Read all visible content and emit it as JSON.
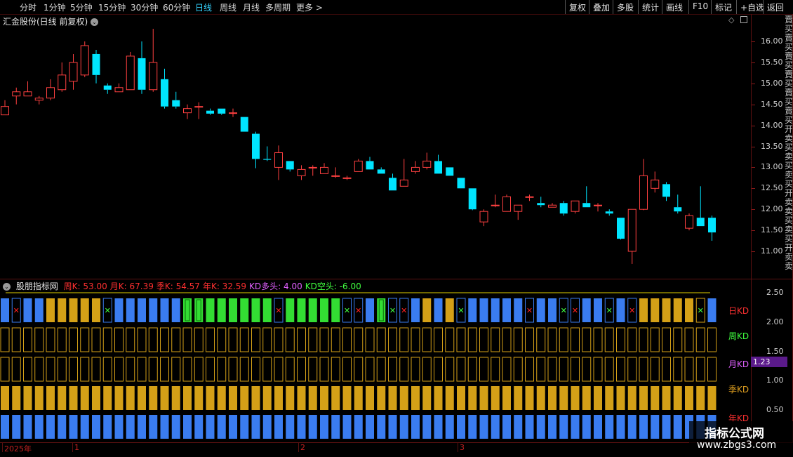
{
  "toolbar": {
    "periods": [
      {
        "label": "分时",
        "active": false
      },
      {
        "label": "1分钟",
        "active": false
      },
      {
        "label": "5分钟",
        "active": false
      },
      {
        "label": "15分钟",
        "active": false
      },
      {
        "label": "30分钟",
        "active": false
      },
      {
        "label": "60分钟",
        "active": false
      },
      {
        "label": "日线",
        "active": true
      },
      {
        "label": "周线",
        "active": false
      },
      {
        "label": "月线",
        "active": false
      },
      {
        "label": "多周期",
        "active": false
      },
      {
        "label": "更多 >",
        "active": false
      }
    ],
    "right_buttons": [
      "复权",
      "叠加",
      "多股",
      "统计",
      "画线",
      "F10",
      "标记",
      "+自选",
      "返回"
    ]
  },
  "stock_title": "汇金股份(日线 前复权)",
  "price_axis": [
    "16.00",
    "15.50",
    "15.00",
    "14.50",
    "14.00",
    "13.50",
    "13.00",
    "12.50",
    "12.00",
    "11.50",
    "11.00"
  ],
  "indicator": {
    "name": "股朋指标网",
    "values": [
      {
        "label": "周K: 53.00",
        "color": "#ff3030"
      },
      {
        "label": "月K: 67.39",
        "color": "#ff3030"
      },
      {
        "label": "季K: 54.57",
        "color": "#ff3030"
      },
      {
        "label": "年K: 32.59",
        "color": "#ff3030"
      },
      {
        "label": "KD多头: 4.00",
        "color": "#e060ff"
      },
      {
        "label": "KD空头: -6.00",
        "color": "#40ff40"
      }
    ],
    "row_labels": [
      {
        "label": "日KD",
        "color": "#ff3030"
      },
      {
        "label": "周KD",
        "color": "#40ff40"
      },
      {
        "label": "月KD",
        "color": "#e060ff"
      },
      {
        "label": "季KD",
        "color": "#e0a020"
      },
      {
        "label": "年KD",
        "color": "#ff3030"
      }
    ],
    "axis": [
      "2.50",
      "2.00",
      "1.50",
      "1.00",
      "0.50"
    ],
    "cursor_value": "1.23"
  },
  "dates": [
    "2025年",
    "1",
    "2",
    "3"
  ],
  "right_edge_text": "賣买賣买賣买賣买賣买賣买开卖买卖买卖买开卖卖买卖买开卖卖",
  "watermark": {
    "title": "指标公式网",
    "url": "www.zbgs3.com"
  },
  "colors": {
    "up": "#ff4040",
    "down": "#00e5ff",
    "blue": "#3a7cf0",
    "gold": "#d4a017",
    "green": "#33dd33"
  },
  "candles": [
    {
      "o": 14.25,
      "c": 14.45,
      "h": 14.6,
      "l": 14.25
    },
    {
      "o": 14.7,
      "c": 14.8,
      "h": 14.9,
      "l": 14.5
    },
    {
      "o": 14.7,
      "c": 14.8,
      "h": 15.05,
      "l": 14.7
    },
    {
      "o": 14.6,
      "c": 14.65,
      "h": 14.7,
      "l": 14.5
    },
    {
      "o": 14.65,
      "c": 14.9,
      "h": 15.1,
      "l": 14.6
    },
    {
      "o": 14.85,
      "c": 15.2,
      "h": 15.5,
      "l": 14.8
    },
    {
      "o": 15.05,
      "c": 15.5,
      "h": 15.7,
      "l": 14.85
    },
    {
      "o": 15.2,
      "c": 15.9,
      "h": 16.0,
      "l": 15.15
    },
    {
      "o": 15.7,
      "c": 15.2,
      "h": 15.8,
      "l": 15.0
    },
    {
      "o": 14.95,
      "c": 14.85,
      "h": 15.0,
      "l": 14.75
    },
    {
      "o": 14.8,
      "c": 14.9,
      "h": 15.0,
      "l": 14.8
    },
    {
      "o": 14.85,
      "c": 15.65,
      "h": 15.75,
      "l": 14.85
    },
    {
      "o": 15.6,
      "c": 14.85,
      "h": 16.0,
      "l": 14.75
    },
    {
      "o": 14.85,
      "c": 15.5,
      "h": 16.3,
      "l": 14.8
    },
    {
      "o": 15.1,
      "c": 14.45,
      "h": 15.35,
      "l": 14.4
    },
    {
      "o": 14.6,
      "c": 14.45,
      "h": 14.8,
      "l": 14.4
    },
    {
      "o": 14.3,
      "c": 14.4,
      "h": 14.5,
      "l": 14.15
    },
    {
      "o": 14.45,
      "c": 14.45,
      "h": 14.55,
      "l": 14.15
    },
    {
      "o": 14.35,
      "c": 14.28,
      "h": 14.4,
      "l": 14.25
    },
    {
      "o": 14.4,
      "c": 14.28,
      "h": 14.4,
      "l": 14.25
    },
    {
      "o": 14.3,
      "c": 14.3,
      "h": 14.4,
      "l": 14.2
    },
    {
      "o": 14.2,
      "c": 13.85,
      "h": 14.2,
      "l": 13.85
    },
    {
      "o": 13.8,
      "c": 13.2,
      "h": 13.85,
      "l": 12.98
    },
    {
      "o": 13.2,
      "c": 13.18,
      "h": 13.5,
      "l": 13.15
    },
    {
      "o": 13.0,
      "c": 13.35,
      "h": 13.52,
      "l": 12.7
    },
    {
      "o": 13.15,
      "c": 12.95,
      "h": 13.15,
      "l": 12.9
    },
    {
      "o": 12.8,
      "c": 12.95,
      "h": 13.05,
      "l": 12.7
    },
    {
      "o": 13.0,
      "c": 13.0,
      "h": 13.05,
      "l": 12.8
    },
    {
      "o": 12.85,
      "c": 13.0,
      "h": 13.1,
      "l": 12.85
    },
    {
      "o": 12.8,
      "c": 12.8,
      "h": 13.0,
      "l": 12.75
    },
    {
      "o": 12.75,
      "c": 12.75,
      "h": 12.8,
      "l": 12.7
    },
    {
      "o": 12.9,
      "c": 13.15,
      "h": 13.2,
      "l": 12.9
    },
    {
      "o": 13.15,
      "c": 12.95,
      "h": 13.25,
      "l": 12.95
    },
    {
      "o": 12.95,
      "c": 12.85,
      "h": 13.0,
      "l": 12.85
    },
    {
      "o": 12.75,
      "c": 12.45,
      "h": 12.85,
      "l": 12.45
    },
    {
      "o": 12.55,
      "c": 12.7,
      "h": 13.2,
      "l": 12.55
    },
    {
      "o": 12.9,
      "c": 13.0,
      "h": 13.15,
      "l": 12.85
    },
    {
      "o": 13.0,
      "c": 13.15,
      "h": 13.35,
      "l": 12.95
    },
    {
      "o": 13.15,
      "c": 12.85,
      "h": 13.3,
      "l": 12.85
    },
    {
      "o": 13.0,
      "c": 12.8,
      "h": 13.0,
      "l": 12.8
    },
    {
      "o": 12.75,
      "c": 12.5,
      "h": 12.75,
      "l": 12.5
    },
    {
      "o": 12.5,
      "c": 12.0,
      "h": 12.5,
      "l": 11.98
    },
    {
      "o": 11.7,
      "c": 11.95,
      "h": 12.0,
      "l": 11.6
    },
    {
      "o": 12.1,
      "c": 12.1,
      "h": 12.35,
      "l": 12.05
    },
    {
      "o": 11.95,
      "c": 12.3,
      "h": 12.35,
      "l": 11.95
    },
    {
      "o": 11.95,
      "c": 12.1,
      "h": 12.1,
      "l": 11.75
    },
    {
      "o": 12.3,
      "c": 12.3,
      "h": 12.35,
      "l": 12.2
    },
    {
      "o": 12.15,
      "c": 12.1,
      "h": 12.3,
      "l": 12.05
    },
    {
      "o": 12.05,
      "c": 12.1,
      "h": 12.15,
      "l": 12.05
    },
    {
      "o": 12.15,
      "c": 11.9,
      "h": 12.2,
      "l": 11.85
    },
    {
      "o": 11.95,
      "c": 12.2,
      "h": 12.2,
      "l": 11.9
    },
    {
      "o": 12.15,
      "c": 12.05,
      "h": 12.55,
      "l": 12.05
    },
    {
      "o": 12.1,
      "c": 12.1,
      "h": 12.15,
      "l": 11.95
    },
    {
      "o": 11.95,
      "c": 11.9,
      "h": 12.0,
      "l": 11.85
    },
    {
      "o": 11.8,
      "c": 11.3,
      "h": 11.8,
      "l": 11.28
    },
    {
      "o": 11.0,
      "c": 12.0,
      "h": 12.0,
      "l": 10.7
    },
    {
      "o": 12.0,
      "c": 12.8,
      "h": 13.2,
      "l": 11.98
    },
    {
      "o": 12.5,
      "c": 12.7,
      "h": 12.9,
      "l": 12.4
    },
    {
      "o": 12.6,
      "c": 12.3,
      "h": 12.65,
      "l": 12.2
    },
    {
      "o": 12.05,
      "c": 11.95,
      "h": 12.35,
      "l": 11.9
    },
    {
      "o": 11.55,
      "c": 11.85,
      "h": 11.9,
      "l": 11.5
    },
    {
      "o": 11.8,
      "c": 11.6,
      "h": 12.55,
      "l": 11.6
    },
    {
      "o": 11.8,
      "c": 11.45,
      "h": 11.85,
      "l": 11.25
    }
  ],
  "day_row": "BBBGGGGBXBBBBBBBBXFGGGGGGGYGGGGXBBFXBBBGGXBBBBBBBXBBBBBXBXBBBBBBBBXBBGGGGGGBXB",
  "markers": {
    "1": "red",
    "9": "green",
    "24": "red",
    "30": "green",
    "31": "red",
    "34": "green",
    "35": "red",
    "40": "green",
    "46": "red",
    "49": "green",
    "50": "red",
    "53": "green",
    "55": "red",
    "61": "green"
  },
  "day_colors": [
    "blue",
    "blue",
    "blue",
    "blue",
    "gold",
    "gold",
    "gold",
    "gold",
    "gold",
    "blue",
    "blue",
    "blue",
    "blue",
    "blue",
    "blue",
    "blue",
    "greenH",
    "greenH",
    "green",
    "green",
    "green",
    "green",
    "green",
    "green",
    "green",
    "green",
    "green",
    "green",
    "green",
    "green",
    "blue",
    "blue",
    "blue",
    "greenH",
    "blue",
    "blue",
    "blue",
    "gold",
    "blue",
    "gold",
    "blue",
    "blue",
    "blue",
    "blue",
    "blue",
    "blue",
    "blue",
    "blue",
    "blue",
    "blue",
    "blue",
    "blue",
    "blue",
    "blue",
    "blue",
    "blue",
    "gold",
    "gold",
    "gold",
    "gold",
    "gold",
    "gold",
    "blue"
  ]
}
